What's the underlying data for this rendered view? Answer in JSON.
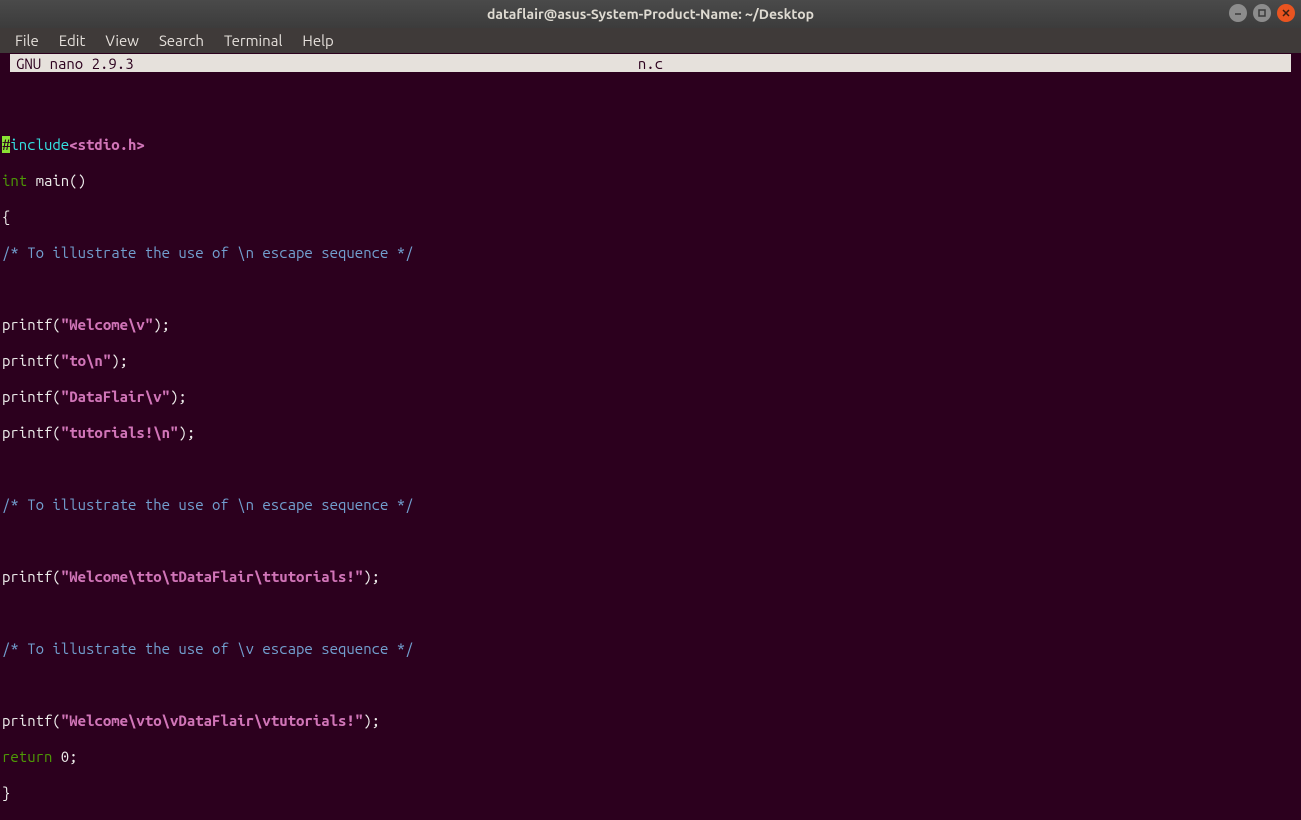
{
  "window": {
    "title": "dataflair@asus-System-Product-Name: ~/Desktop"
  },
  "menu": {
    "file": "File",
    "edit": "Edit",
    "view": "View",
    "search": "Search",
    "terminal": "Terminal",
    "help": "Help"
  },
  "nano": {
    "version": "GNU nano 2.9.3",
    "filename": "n.c"
  },
  "code": {
    "l01_cursor": "#",
    "l01_pre": "include",
    "l01_hdr": "<stdio.h>",
    "l02_type": "int",
    "l02_rest": " main()",
    "l03": "{",
    "l04_cmt": "/* To illustrate the use of \\n escape sequence */",
    "l05_a": "printf(",
    "l05_s": "\"Welcome\\v\"",
    "l05_b": ");",
    "l06_a": "printf(",
    "l06_s": "\"to\\n\"",
    "l06_b": ");",
    "l07_a": "printf(",
    "l07_s": "\"DataFlair\\v\"",
    "l07_b": ");",
    "l08_a": "printf(",
    "l08_s": "\"tutorials!\\n\"",
    "l08_b": ");",
    "l09_cmt": "/* To illustrate the use of \\n escape sequence */",
    "l10_a": "printf(",
    "l10_s": "\"Welcome\\tto\\tDataFlair\\ttutorials!\"",
    "l10_b": ");",
    "l11_cmt": "/* To illustrate the use of \\v escape sequence */",
    "l12_a": "printf(",
    "l12_s": "\"Welcome\\vto\\vDataFlair\\vtutorials!\"",
    "l12_b": ");",
    "l13_ret": "return",
    "l13_rest": " 0;",
    "l14": "}"
  }
}
